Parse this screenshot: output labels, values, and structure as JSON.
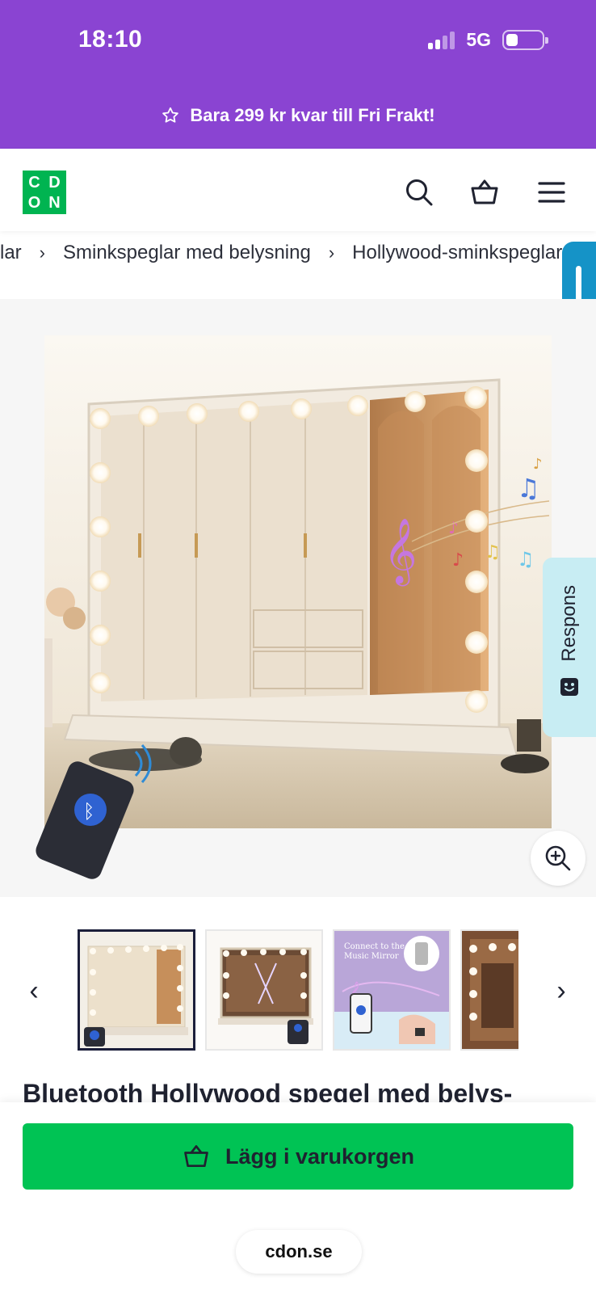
{
  "status_bar": {
    "time": "18:10",
    "network": "5G",
    "signal_level": 0.5,
    "battery_level": 0.35
  },
  "promo_banner": {
    "text": "Bara 299 kr kvar till Fri Frakt!",
    "icon": "star-outline-icon"
  },
  "header": {
    "logo_letters": [
      "C",
      "D",
      "O",
      "N"
    ],
    "icons": [
      "search-icon",
      "basket-icon",
      "menu-icon"
    ]
  },
  "breadcrumb": {
    "items": [
      "lar",
      "Sminkspeglar med belysning",
      "Hollywood-sminkspeglar"
    ]
  },
  "feedback_tab": {
    "label": "Respons",
    "icon": "smiley-icon"
  },
  "product": {
    "title": "Bluetooth Hollywood spegel med belys-",
    "thumbnail_count": 4,
    "active_thumbnail": 1,
    "thumbnail_3_text": "Connect to the Music Mirror"
  },
  "actions": {
    "add_to_cart": "Lägg i varukorgen"
  },
  "browser": {
    "domain": "cdon.se"
  },
  "colors": {
    "banner_purple": "#8a44d2",
    "brand_green": "#00b451",
    "cart_green": "#00c354",
    "feedback_bg": "#c8edf3",
    "scroll_tab_blue": "#1593c7"
  }
}
